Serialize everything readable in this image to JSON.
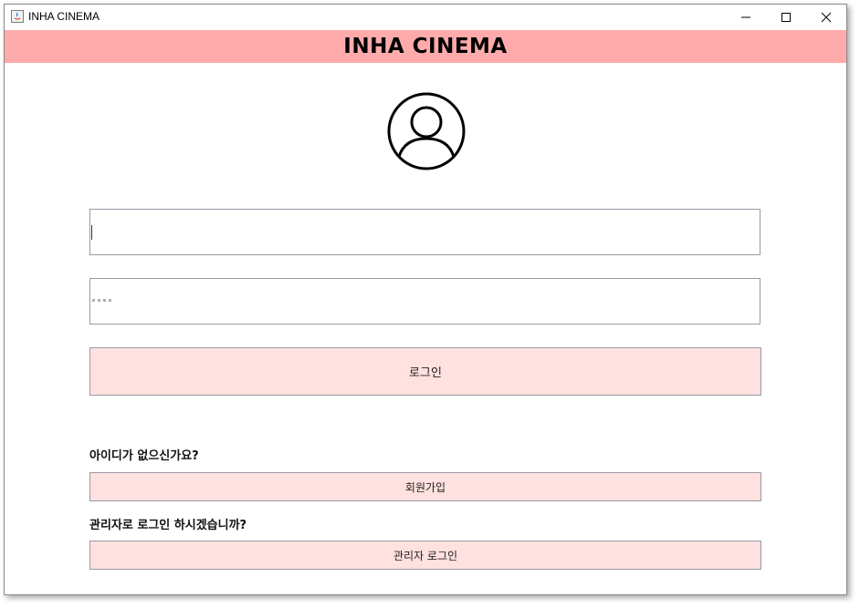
{
  "window": {
    "title": "INHA CINEMA",
    "controls": {
      "minimize": "minimize-icon",
      "maximize": "maximize-icon",
      "close": "close-icon"
    }
  },
  "header": {
    "title": "INHA CINEMA",
    "background": "#ffabab"
  },
  "login_form": {
    "avatar_icon": "user-circle-icon",
    "id_value": "",
    "password_value": "••••",
    "login_label": "로그인",
    "signup_prompt": "아이디가 없으신가요?",
    "signup_label": "회원가입",
    "admin_prompt": "관리자로 로그인 하시겠습니까?",
    "admin_label": "관리자 로그인",
    "button_color": "#ffe1df"
  }
}
